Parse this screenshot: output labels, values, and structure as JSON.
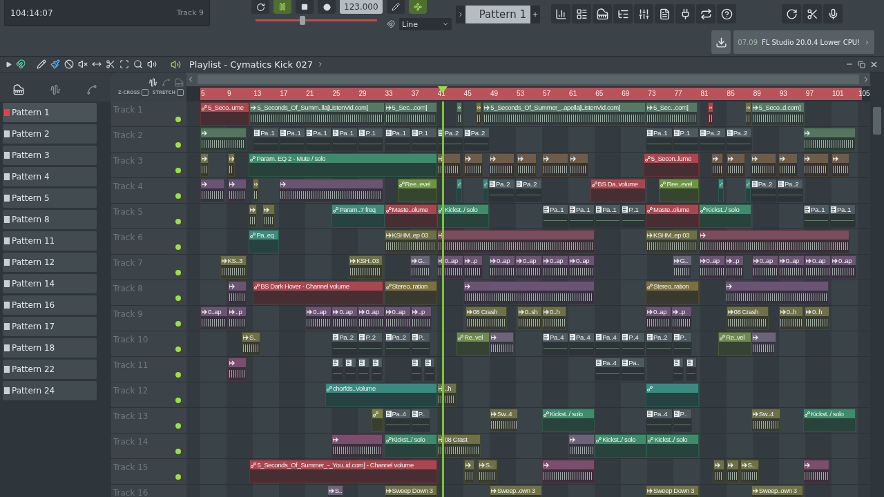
{
  "top_bar": {
    "time": "104:14:07",
    "track": "Track 9",
    "playing": true,
    "tempo": "123.000",
    "pitch": {
      "level": 0.38
    },
    "snap": "Line",
    "pattern": "Pattern 1",
    "hint_time": "07.09",
    "hint": "FL Studio 20.0.4 Lower CPU!"
  },
  "playlist": {
    "title": "Playlist - Cymatics Kick 027",
    "options": [
      {
        "label": "Z-CROSS",
        "checked": false
      },
      {
        "label": "STRETCH",
        "checked": false
      }
    ],
    "patterns": [
      {
        "name": "Pattern 1",
        "selected": true
      },
      {
        "name": "Pattern 2",
        "selected": false
      },
      {
        "name": "Pattern 3",
        "selected": false
      },
      {
        "name": "Pattern 4",
        "selected": false
      },
      {
        "name": "Pattern 5",
        "selected": false
      },
      {
        "name": "Pattern 8",
        "selected": false
      },
      {
        "name": "Pattern 11",
        "selected": false
      },
      {
        "name": "Pattern 12",
        "selected": false
      },
      {
        "name": "Pattern 14",
        "selected": false
      },
      {
        "name": "Pattern 16",
        "selected": false
      },
      {
        "name": "Pattern 17",
        "selected": false
      },
      {
        "name": "Pattern 18",
        "selected": false
      },
      {
        "name": "Pattern 22",
        "selected": false
      },
      {
        "name": "Pattern 24",
        "selected": false
      }
    ],
    "ruler": [
      "5",
      "9",
      "13",
      "17",
      "21",
      "25",
      "29",
      "33",
      "37",
      "41",
      "45",
      "49",
      "53",
      "57",
      "61",
      "65",
      "69",
      "73",
      "77",
      "81",
      "85",
      "89",
      "93",
      "97",
      "101",
      "105"
    ],
    "tracks": [
      {
        "name": "Track 1",
        "clips": [
          {
            "kind": "automation",
            "label": "5_Seco..ume",
            "color": "#a8474f"
          },
          {
            "kind": "audio",
            "label": "5_Seconds_Of_Summ..lla[ListenVid.com]",
            "color": "#587866"
          },
          {
            "kind": "audio",
            "label": "5_Sec...com]",
            "color": "#587866"
          },
          {
            "kind": "audio",
            "color": "#587866"
          },
          {
            "kind": "audio",
            "color": "#6e7048"
          },
          {
            "kind": "audio",
            "label": "5_Seconds_Of_Summer_..apella[ListenVid.com]",
            "color": "#587866"
          },
          {
            "kind": "audio",
            "label": "5_Sec...com]",
            "color": "#587866"
          },
          {
            "kind": "audio",
            "color": "#a8474f"
          },
          {
            "kind": "audio",
            "color": "#6e7048"
          },
          {
            "kind": "audio",
            "label": "5_Seco..d.com]",
            "color": "#587866"
          }
        ]
      },
      {
        "name": "Track 2",
        "clips": [
          {
            "kind": "audio",
            "color": "#557560"
          },
          {
            "kind": "pattern",
            "label": "Pa..1",
            "color": "#4d5a5f"
          },
          {
            "kind": "pattern",
            "label": "Pa..1",
            "color": "#4d5a5f"
          },
          {
            "kind": "pattern",
            "label": "Pa..1",
            "color": "#4d5a5f"
          },
          {
            "kind": "pattern",
            "label": "Pa..1",
            "color": "#4d5a5f"
          },
          {
            "kind": "pattern",
            "label": "P..1",
            "color": "#4d5a5f"
          },
          {
            "kind": "pattern",
            "label": "Pa..1",
            "color": "#4d5a5f"
          },
          {
            "kind": "pattern",
            "label": "P..1",
            "color": "#4d5a5f"
          },
          {
            "kind": "pattern",
            "label": "Pa..2",
            "color": "#4d5a5f"
          },
          {
            "kind": "pattern",
            "label": "Pa..2",
            "color": "#4d5a5f"
          },
          {
            "kind": "pattern",
            "label": "Pa..1",
            "color": "#4d5a5f"
          },
          {
            "kind": "pattern",
            "label": "P..1",
            "color": "#4d5a5f"
          },
          {
            "kind": "pattern",
            "label": "Pa..2",
            "color": "#4d5a5f"
          },
          {
            "kind": "pattern",
            "label": "Pa..2",
            "color": "#4d5a5f"
          },
          {
            "kind": "audio",
            "color": "#557560"
          }
        ]
      },
      {
        "name": "Track 3",
        "clips": [
          {
            "kind": "audio",
            "color": "#6e7048"
          },
          {
            "kind": "audio",
            "color": "#6e7048"
          },
          {
            "kind": "automation",
            "label": "Param. EQ 2 - Mute / solo",
            "color": "#3f8a6a"
          },
          {
            "kind": "audio",
            "color": "#6e5c4a"
          },
          {
            "kind": "audio",
            "color": "#6e5c4a"
          },
          {
            "kind": "audio",
            "color": "#6e5c4a"
          },
          {
            "kind": "audio",
            "color": "#6e5c4a"
          },
          {
            "kind": "audio",
            "color": "#6e5c4a"
          },
          {
            "kind": "audio",
            "color": "#6e5c4a"
          },
          {
            "kind": "automation",
            "label": "5_Secon..lume",
            "color": "#a8474f"
          },
          {
            "kind": "audio",
            "color": "#6e5c4a"
          },
          {
            "kind": "audio",
            "color": "#6e5c4a"
          },
          {
            "kind": "audio",
            "color": "#6e5c4a"
          },
          {
            "kind": "audio",
            "color": "#6e5c4a"
          },
          {
            "kind": "audio",
            "color": "#6e5c4a"
          },
          {
            "kind": "audio",
            "color": "#6e5c4a"
          }
        ]
      },
      {
        "name": "Track 4",
        "clips": [
          {
            "kind": "audio",
            "color": "#6b5473"
          },
          {
            "kind": "audio",
            "color": "#6b5473"
          },
          {
            "kind": "audio",
            "color": "#6e7048"
          },
          {
            "kind": "audio",
            "color": "#6b5473"
          },
          {
            "kind": "automation",
            "label": "Ree..evel",
            "color": "#6e9440"
          },
          {
            "kind": "automation",
            "color": "#3f8a7a"
          },
          {
            "kind": "automation",
            "color": "#3f8a7a"
          },
          {
            "kind": "pattern",
            "label": "Pa..2",
            "color": "#4d5a5f"
          },
          {
            "kind": "pattern",
            "label": "Pa..2",
            "color": "#4d5a5f"
          },
          {
            "kind": "automation",
            "label": "BS Da..volume",
            "color": "#a8474f"
          },
          {
            "kind": "automation",
            "label": "Ree..evel",
            "color": "#6e9440"
          },
          {
            "kind": "automation",
            "color": "#3f8a7a"
          },
          {
            "kind": "automation",
            "color": "#3f8a7a"
          },
          {
            "kind": "pattern",
            "label": "Pa..2",
            "color": "#4d5a5f"
          },
          {
            "kind": "pattern",
            "label": "Pa..2",
            "color": "#4d5a5f"
          }
        ]
      },
      {
        "name": "Track 5",
        "clips": [
          {
            "kind": "audio",
            "color": "#6e7048"
          },
          {
            "kind": "audio",
            "color": "#6e7048"
          },
          {
            "kind": "automation",
            "label": "Param..7 freq",
            "color": "#3f8a7a"
          },
          {
            "kind": "automation",
            "label": "Maste..olume",
            "color": "#a8474f"
          },
          {
            "kind": "automation",
            "label": "Kickst../ solo",
            "color": "#3e8c6a"
          },
          {
            "kind": "pattern",
            "label": "Pa..1",
            "color": "#4d5a5f"
          },
          {
            "kind": "pattern",
            "label": "Pa..1",
            "color": "#4d5a5f"
          },
          {
            "kind": "pattern",
            "label": "Pa..1",
            "color": "#4d5a5f"
          },
          {
            "kind": "pattern",
            "label": "P..1",
            "color": "#4d5a5f"
          },
          {
            "kind": "automation",
            "label": "Maste..olume",
            "color": "#a8474f"
          },
          {
            "kind": "automation",
            "label": "Kickst../ solo",
            "color": "#3e8c6a"
          },
          {
            "kind": "pattern",
            "label": "Pa..1",
            "color": "#4d5a5f"
          },
          {
            "kind": "pattern",
            "label": "Pa..1",
            "color": "#4d5a5f"
          }
        ]
      },
      {
        "name": "Track 6",
        "clips": [
          {
            "kind": "automation",
            "label": "Pa..eq",
            "color": "#3f8a7a"
          },
          {
            "kind": "audio",
            "label": "KSHM..ep 03",
            "color": "#6e7048"
          },
          {
            "kind": "audio",
            "color": "#7a4e5c"
          },
          {
            "kind": "audio",
            "label": "KSHM..ep 03",
            "color": "#6e7048"
          },
          {
            "kind": "audio",
            "color": "#7a4e5c"
          }
        ]
      },
      {
        "name": "Track 7",
        "clips": [
          {
            "kind": "audio",
            "label": "KS..3",
            "color": "#6e7048"
          },
          {
            "kind": "audio",
            "label": "KSH..03",
            "color": "#6e7048"
          },
          {
            "kind": "audio",
            "label": "G..",
            "color": "#6b6478"
          },
          {
            "kind": "audio",
            "label": "0..ap",
            "color": "#6b5473"
          },
          {
            "kind": "audio",
            "label": "..p",
            "color": "#6b5473"
          },
          {
            "kind": "audio",
            "label": "0..ap",
            "color": "#6b5473"
          },
          {
            "kind": "audio",
            "label": "0..ap",
            "color": "#6b5473"
          },
          {
            "kind": "audio",
            "label": "0..ap",
            "color": "#6b5473"
          },
          {
            "kind": "audio",
            "label": "0..ap",
            "color": "#6b5473"
          },
          {
            "kind": "audio",
            "label": "G..",
            "color": "#6b6478"
          },
          {
            "kind": "audio",
            "label": "0..ap",
            "color": "#6b5473"
          },
          {
            "kind": "audio",
            "label": "..p",
            "color": "#6b5473"
          },
          {
            "kind": "audio",
            "label": "0..ap",
            "color": "#6b5473"
          },
          {
            "kind": "audio",
            "label": "0..ap",
            "color": "#6b5473"
          },
          {
            "kind": "audio",
            "label": "0..ap",
            "color": "#6b5473"
          },
          {
            "kind": "audio",
            "label": "0..ap",
            "color": "#6b5473"
          }
        ]
      },
      {
        "name": "Track 8",
        "clips": [
          {
            "kind": "audio",
            "color": "#6b5473"
          },
          {
            "kind": "automation",
            "label": "BS Dark Hover - Channel volume",
            "color": "#a8474f"
          },
          {
            "kind": "automation",
            "label": "Stereo..ration",
            "color": "#7a7040"
          },
          {
            "kind": "audio",
            "color": "#6b5473"
          },
          {
            "kind": "automation",
            "label": "Stereo..ration",
            "color": "#7a7040"
          },
          {
            "kind": "audio",
            "color": "#6b5473"
          }
        ]
      },
      {
        "name": "Track 9",
        "clips": [
          {
            "kind": "audio",
            "label": "0..ap",
            "color": "#6b5473"
          },
          {
            "kind": "audio",
            "label": "..p",
            "color": "#6b5473"
          },
          {
            "kind": "audio",
            "label": "0..ap",
            "color": "#6b5473"
          },
          {
            "kind": "audio",
            "label": "0..ap",
            "color": "#6b5473"
          },
          {
            "kind": "audio",
            "label": "0..ap",
            "color": "#6b5473"
          },
          {
            "kind": "audio",
            "label": "0..ap",
            "color": "#6b5473"
          },
          {
            "kind": "audio",
            "label": "..p",
            "color": "#6b5473"
          },
          {
            "kind": "audio",
            "label": "08 Crash",
            "color": "#6e7048"
          },
          {
            "kind": "audio",
            "label": "0..sh",
            "color": "#6e7048"
          },
          {
            "kind": "audio",
            "label": "0..h",
            "color": "#6e7048"
          },
          {
            "kind": "audio",
            "label": "0..ap",
            "color": "#6b5473"
          },
          {
            "kind": "audio",
            "label": "..p",
            "color": "#6b5473"
          },
          {
            "kind": "audio",
            "label": "08 Crash",
            "color": "#6e7048"
          },
          {
            "kind": "audio",
            "label": "0..h",
            "color": "#6e7048"
          },
          {
            "kind": "audio",
            "label": "0..h",
            "color": "#6e7048"
          }
        ]
      },
      {
        "name": "Track 10",
        "clips": [
          {
            "kind": "audio",
            "label": "S..",
            "color": "#6e7048"
          },
          {
            "kind": "pattern",
            "label": "Pa..2",
            "color": "#4d5a5f"
          },
          {
            "kind": "pattern",
            "label": "P..2",
            "color": "#4d5a5f"
          },
          {
            "kind": "pattern",
            "label": "Pa..2",
            "color": "#4d5a5f"
          },
          {
            "kind": "pattern",
            "label": "P..",
            "color": "#4d5a5f"
          },
          {
            "kind": "automation",
            "label": "Re..vel",
            "color": "#6e8a50"
          },
          {
            "kind": "audio",
            "color": "#6b6478"
          },
          {
            "kind": "pattern",
            "label": "Pa..4",
            "color": "#4d5a5f"
          },
          {
            "kind": "pattern",
            "label": "Pa..4",
            "color": "#4d5a5f"
          },
          {
            "kind": "pattern",
            "label": "Pa..4",
            "color": "#4d5a5f"
          },
          {
            "kind": "pattern",
            "label": "P..4",
            "color": "#4d5a5f"
          },
          {
            "kind": "pattern",
            "label": "Pa..2",
            "color": "#4d5a5f"
          },
          {
            "kind": "pattern",
            "label": "P..",
            "color": "#4d5a5f"
          },
          {
            "kind": "automation",
            "label": "Re..vel",
            "color": "#6e8a50"
          },
          {
            "kind": "audio",
            "color": "#6b6478"
          }
        ]
      },
      {
        "name": "Track 11",
        "clips": [
          {
            "kind": "audio",
            "color": "#7a4e6c"
          },
          {
            "kind": "pattern",
            "color": "#4d5a5f"
          },
          {
            "kind": "pattern",
            "color": "#4d5a5f"
          },
          {
            "kind": "pattern",
            "color": "#4d5a5f"
          },
          {
            "kind": "pattern",
            "color": "#4d5a5f"
          },
          {
            "kind": "pattern",
            "color": "#4d5a5f"
          },
          {
            "kind": "pattern",
            "color": "#4d5a5f"
          },
          {
            "kind": "pattern",
            "label": "Pa..4",
            "color": "#4d5a5f"
          },
          {
            "kind": "pattern",
            "label": "Pa..",
            "color": "#4d5a5f"
          },
          {
            "kind": "pattern",
            "color": "#4d5a5f"
          },
          {
            "kind": "pattern",
            "color": "#4d5a5f"
          }
        ]
      },
      {
        "name": "Track 12",
        "clips": [
          {
            "kind": "automation",
            "label": "chorfds..Volume",
            "color": "#3a8a82"
          },
          {
            "kind": "audio",
            "label": "..h",
            "color": "#6e7048"
          },
          {
            "kind": "automation",
            "color": "#3a8a82"
          }
        ]
      },
      {
        "name": "Track 13",
        "clips": [
          {
            "kind": "automation",
            "color": "#7a8040"
          },
          {
            "kind": "pattern",
            "label": "Pa..4",
            "color": "#4d5a5f"
          },
          {
            "kind": "pattern",
            "label": "P..",
            "color": "#4d5a5f"
          },
          {
            "kind": "audio",
            "label": "Sw..4",
            "color": "#6e7048"
          },
          {
            "kind": "automation",
            "label": "Kickst../ solo",
            "color": "#3e8c6a"
          },
          {
            "kind": "pattern",
            "label": "Pa..4",
            "color": "#4d5a5f"
          },
          {
            "kind": "pattern",
            "label": "P..",
            "color": "#4d5a5f"
          },
          {
            "kind": "audio",
            "label": "Sw..4",
            "color": "#6e7048"
          },
          {
            "kind": "automation",
            "label": "Kickst../ solo",
            "color": "#3e8c6a"
          }
        ]
      },
      {
        "name": "Track 14",
        "clips": [
          {
            "kind": "audio",
            "color": "#7a4e6c"
          },
          {
            "kind": "automation",
            "label": "Kickst../ solo",
            "color": "#3e8c6a"
          },
          {
            "kind": "audio",
            "label": "08 Crast",
            "color": "#6e7048"
          },
          {
            "kind": "audio",
            "color": "#6b6478"
          },
          {
            "kind": "automation",
            "label": "Kickst../ solo",
            "color": "#3e8c6a"
          },
          {
            "kind": "automation",
            "label": "Kickst../ solo",
            "color": "#3e8c6a"
          }
        ]
      },
      {
        "name": "Track 15",
        "clips": [
          {
            "kind": "automation",
            "label": "5_Seconds_Of_Summer_-_You..id.com] - Channel volume",
            "color": "#a8474f"
          },
          {
            "kind": "audio",
            "color": "#6e7048"
          },
          {
            "kind": "audio",
            "label": "S..",
            "color": "#6e7048"
          },
          {
            "kind": "audio",
            "color": "#7a4e6c"
          },
          {
            "kind": "audio",
            "color": "#6e7048"
          },
          {
            "kind": "audio",
            "color": "#6e7048"
          },
          {
            "kind": "audio",
            "label": "S..",
            "color": "#6e7048"
          },
          {
            "kind": "audio",
            "color": "#7a4e6c"
          }
        ]
      },
      {
        "name": "Track 16",
        "clips": [
          {
            "kind": "audio",
            "label": "S..",
            "color": "#6b6478"
          },
          {
            "kind": "audio",
            "label": "Sweep Down 3",
            "color": "#6e7048"
          },
          {
            "kind": "audio",
            "label": "Sweep..own 3",
            "color": "#6e7048"
          },
          {
            "kind": "audio",
            "label": "Sweep Down 3",
            "color": "#6e7048"
          },
          {
            "kind": "audio",
            "label": "Sweep..own 3",
            "color": "#6e7048"
          }
        ]
      }
    ]
  }
}
